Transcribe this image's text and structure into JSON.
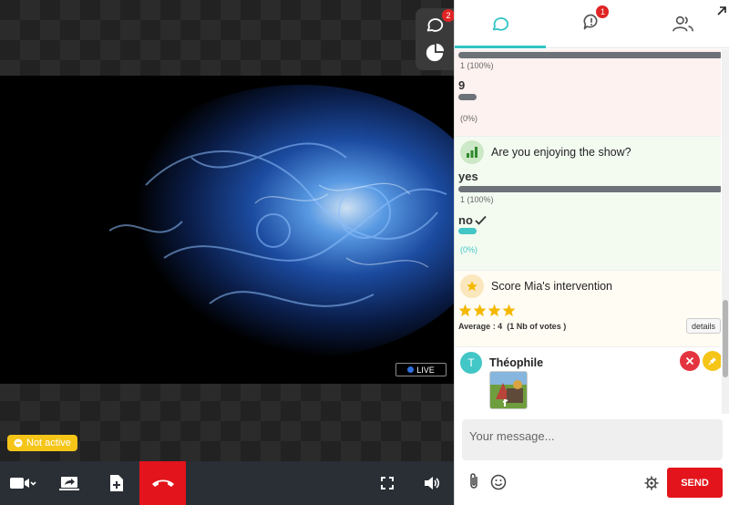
{
  "stage": {
    "live_label": "LIVE",
    "status_label": "Not active",
    "chat_badge": "2"
  },
  "tabs": {
    "alerts_badge": "1"
  },
  "polls": [
    {
      "options": [
        {
          "label": "",
          "result": "1 (100%)",
          "fraction": 1.0
        },
        {
          "label": "9",
          "result": "(0%)",
          "fraction": 0.0
        }
      ]
    },
    {
      "question": "Are you enjoying the show?",
      "options": [
        {
          "label": "yes",
          "result": "1 (100%)",
          "fraction": 1.0
        },
        {
          "label": "no",
          "result": "(0%)",
          "fraction": 0.0,
          "checked": true
        }
      ]
    },
    {
      "question": "Score Mia's intervention",
      "rating": 4,
      "rating_max": 4,
      "average_text": "Average : 4  (1 Nb of votes )",
      "details_label": "details"
    }
  ],
  "message": {
    "avatar_letter": "T",
    "author": "Théophile"
  },
  "composer": {
    "placeholder": "Your message...",
    "send_label": "SEND"
  },
  "colors": {
    "accent": "#32c4c4",
    "danger": "#e3141b",
    "star": "#f5b800",
    "bar": "#6d7178"
  }
}
